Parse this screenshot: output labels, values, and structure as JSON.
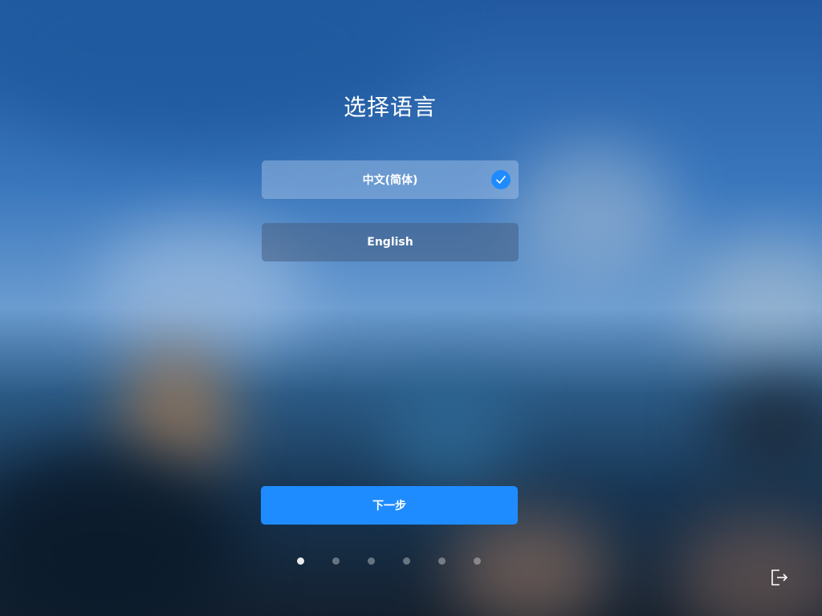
{
  "title": "选择语言",
  "languages": [
    {
      "label": "中文(简体)",
      "selected": true
    },
    {
      "label": "English",
      "selected": false
    }
  ],
  "next_button": {
    "label": "下一步"
  },
  "steps": {
    "total": 6,
    "current": 1
  },
  "icons": {
    "selected_check": "check-icon",
    "exit": "exit-icon"
  },
  "colors": {
    "accent": "#1e8cff",
    "check": "#1f8bff"
  }
}
